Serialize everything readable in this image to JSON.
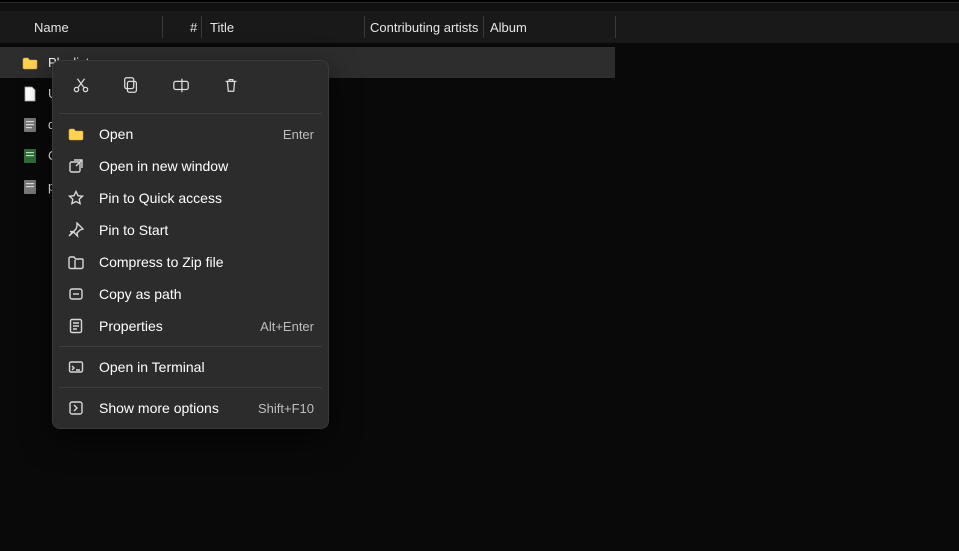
{
  "columns": {
    "name": "Name",
    "hash": "#",
    "title": "Title",
    "contrib": "Contributing artists",
    "album": "Album"
  },
  "rows": [
    {
      "name": "Playlists",
      "type": "folder",
      "selected": true
    },
    {
      "name": "U",
      "type": "file"
    },
    {
      "name": "d",
      "type": "file"
    },
    {
      "name": "C",
      "type": "file"
    },
    {
      "name": "pa",
      "type": "file"
    }
  ],
  "context_menu": {
    "icons": [
      "cut",
      "copy",
      "rename",
      "delete"
    ],
    "groups": [
      [
        {
          "icon": "folder",
          "label": "Open",
          "shortcut": "Enter"
        },
        {
          "icon": "newwin",
          "label": "Open in new window"
        },
        {
          "icon": "star",
          "label": "Pin to Quick access"
        },
        {
          "icon": "pin",
          "label": "Pin to Start"
        },
        {
          "icon": "zip",
          "label": "Compress to Zip file"
        },
        {
          "icon": "path",
          "label": "Copy as path"
        },
        {
          "icon": "props",
          "label": "Properties",
          "shortcut": "Alt+Enter"
        }
      ],
      [
        {
          "icon": "terminal",
          "label": "Open in Terminal"
        }
      ],
      [
        {
          "icon": "more",
          "label": "Show more options",
          "shortcut": "Shift+F10"
        }
      ]
    ]
  }
}
